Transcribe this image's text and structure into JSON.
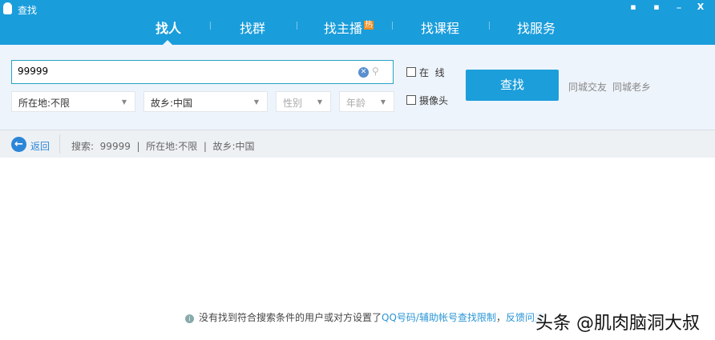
{
  "window": {
    "title": "查找",
    "controls": [
      "feedback",
      "lock",
      "minimize",
      "close"
    ],
    "close_label": "X",
    "min_label": "_"
  },
  "tabs": [
    {
      "label": "找人",
      "active": true
    },
    {
      "label": "找群"
    },
    {
      "label": "找主播",
      "badge": "热"
    },
    {
      "label": "找课程"
    },
    {
      "label": "找服务"
    }
  ],
  "search": {
    "value": "99999"
  },
  "filters": {
    "location": "所在地:不限",
    "hometown": "故乡:中国",
    "gender": "性别",
    "age": "年龄"
  },
  "checkboxes": {
    "online": "在  线",
    "camera": "摄像头"
  },
  "find_button": "查找",
  "links": [
    "同城交友",
    "同城老乡"
  ],
  "breadcrumb": {
    "back": "返回",
    "text": "搜索:  99999  |  所在地:不限  |  故乡:中国"
  },
  "result": {
    "message": "没有找到符合搜索条件的用户或对方设置了",
    "link1": "QQ号码/辅助帐号查找限制",
    "comma": "，",
    "link2": "反馈问题"
  },
  "watermark": "头条 @肌肉脑洞大叔",
  "colors": {
    "brand": "#1a9ddb",
    "link": "#2a95d5"
  }
}
